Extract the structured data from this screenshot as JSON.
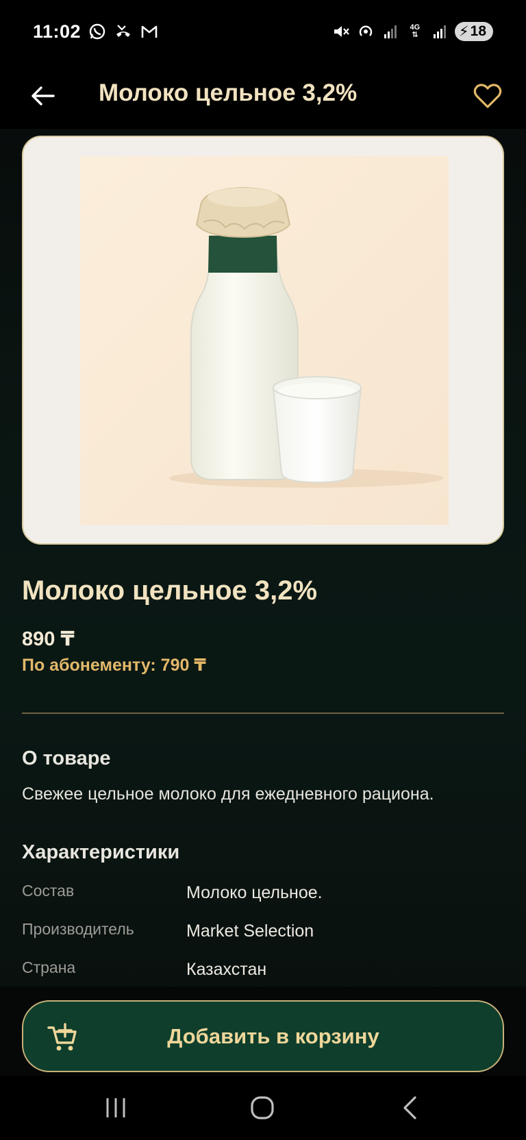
{
  "status_bar": {
    "time": "11:02",
    "network_label": "4G",
    "battery": "18",
    "icons": [
      "whatsapp-icon",
      "missed-call-icon",
      "gmail-icon",
      "mute-icon",
      "hotspot-icon",
      "signal-icon",
      "4g-icon",
      "signal-icon",
      "battery-charging-icon"
    ]
  },
  "app_bar": {
    "title": "Молоко цельное 3,2%",
    "back_icon": "arrow-left-icon",
    "favorite_icon": "heart-outline-icon"
  },
  "product": {
    "image_alt": "bottle-and-cup-of-milk",
    "title": "Молоко цельное 3,2%",
    "price": "890 ₸",
    "subscription_price": "По абонементу: 790 ₸"
  },
  "about": {
    "heading": "О товаре",
    "text": "Свежее цельное молоко для ежедневного рациона."
  },
  "specs": {
    "heading": "Характеристики",
    "rows": [
      {
        "label": "Состав",
        "value": "Молоко цельное."
      },
      {
        "label": "Производитель",
        "value": "Market Selection"
      },
      {
        "label": "Страна",
        "value": "Казахстан"
      }
    ]
  },
  "cta": {
    "label": "Добавить в корзину",
    "icon": "add-to-cart-icon"
  },
  "nav": {
    "icons": [
      "recents-icon",
      "home-icon",
      "back-icon"
    ]
  },
  "colors": {
    "accent_gold": "#f1e2c0",
    "subscription_price": "#e3b86a",
    "button_bg": "#0f3f2c",
    "button_border": "#c9b27a"
  }
}
